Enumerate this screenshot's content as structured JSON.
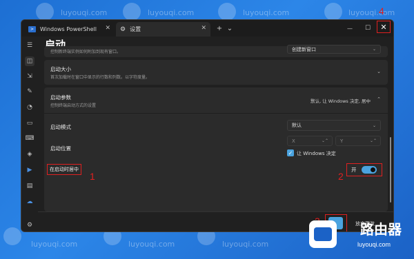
{
  "window": {
    "tabs": [
      {
        "label": "Windows PowerShell"
      },
      {
        "label": "设置"
      }
    ],
    "new_tab": "+",
    "tab_dropdown": "⌄",
    "minimize": "—",
    "maximize": "☐",
    "close": "✕"
  },
  "page": {
    "title": "启动"
  },
  "sections": {
    "new_instance": {
      "desc": "控制新终端实例如何附加到现有窗口。",
      "value": "创建新窗口"
    },
    "launch_size": {
      "title": "启动大小",
      "desc": "首次加载时在窗口中显示的行数和列数。以字符度量。"
    },
    "launch_params": {
      "title": "启动参数",
      "desc": "控制终端启动方式的设置",
      "summary": "默认, 让 Windows 决定, 居中",
      "launch_mode_label": "启动模式",
      "launch_mode_value": "默认",
      "launch_pos_label": "启动位置",
      "x_placeholder": "X",
      "y_placeholder": "Y",
      "let_windows_decide": "让 Windows 决定",
      "center_label": "在启动时居中",
      "toggle_label": "开"
    }
  },
  "footer": {
    "save_label": "保存",
    "discard_label": "放弃更改"
  },
  "annotations": {
    "n1": "1",
    "n2": "2",
    "n3": "3",
    "n4": "4"
  },
  "watermark": {
    "brand": "路由器",
    "url": "luyouqi.com"
  },
  "colors": {
    "accent": "#4aa3df",
    "annotation_red": "#e02020",
    "window_bg": "#202020",
    "card_bg": "#2b2b2b",
    "desktop_blue": "#1d6fd3"
  }
}
